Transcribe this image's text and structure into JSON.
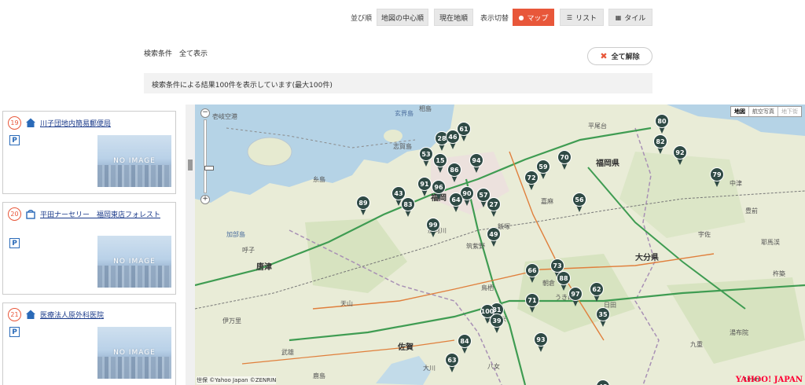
{
  "toolbar": {
    "sort_label": "並び順",
    "sort_center": "地図の中心順",
    "sort_current": "現在地順",
    "view_label": "表示切替",
    "view_map": "マップ",
    "view_list": "リスト",
    "view_tile": "タイル"
  },
  "conditions": {
    "label": "検索条件",
    "value": "全て表示",
    "clear": "全て解除"
  },
  "result_text": "検索条件による結果100件を表示しています(最大100件)",
  "list": [
    {
      "num": "19",
      "title": "川子団地内簡易郵便局",
      "category_icon": "house-icon",
      "parking": "P",
      "image_text": "NO IMAGE"
    },
    {
      "num": "20",
      "title": "平田ナーセリー　福岡東店フォレスト",
      "category_icon": "shop-icon",
      "parking": "P",
      "image_text": "NO IMAGE"
    },
    {
      "num": "21",
      "title": "医療法人原外科医院",
      "category_icon": "house-icon",
      "parking": "P",
      "image_text": "NO IMAGE"
    }
  ],
  "map": {
    "type_buttons": [
      "地図",
      "航空写真",
      "地下街"
    ],
    "credit": "世保  ©Yahoo Japan ©ZENRIN",
    "scale": "10 km",
    "logo": "YAHOO! JAPAN",
    "accent": "#e8573a",
    "marker_color": "#2f4a45",
    "place_labels": [
      {
        "text": "壱岐空港"
      },
      {
        "text": "玄界島"
      },
      {
        "text": "相島"
      },
      {
        "text": "志賀島"
      },
      {
        "text": "平尾台"
      },
      {
        "text": "福岡県"
      },
      {
        "text": "大分県"
      },
      {
        "text": "佐賀"
      },
      {
        "text": "唐津"
      },
      {
        "text": "福岡"
      },
      {
        "text": "那珂川"
      },
      {
        "text": "久留米"
      },
      {
        "text": "鳥栖"
      },
      {
        "text": "筑紫野"
      },
      {
        "text": "飯塚"
      },
      {
        "text": "嘉麻"
      },
      {
        "text": "朝倉"
      },
      {
        "text": "日田"
      },
      {
        "text": "中津"
      },
      {
        "text": "豊前"
      },
      {
        "text": "糸島"
      },
      {
        "text": "伊万里"
      },
      {
        "text": "武雄"
      },
      {
        "text": "鹿島"
      },
      {
        "text": "大川"
      },
      {
        "text": "八女"
      },
      {
        "text": "うきは"
      },
      {
        "text": "耶馬渓"
      },
      {
        "text": "宇佐"
      },
      {
        "text": "加部島"
      },
      {
        "text": "呼子"
      },
      {
        "text": "天山"
      },
      {
        "text": "九重"
      },
      {
        "text": "杵築"
      },
      {
        "text": "湯布院"
      }
    ],
    "markers": [
      "61",
      "80",
      "53",
      "28",
      "46",
      "15",
      "94",
      "86",
      "82",
      "92",
      "70",
      "59",
      "72",
      "79",
      "91",
      "96",
      "90",
      "57",
      "27",
      "43",
      "83",
      "64",
      "56",
      "89",
      "99",
      "49",
      "66",
      "73",
      "88",
      "62",
      "97",
      "71",
      "63",
      "81",
      "100",
      "39",
      "35",
      "84",
      "93",
      "48"
    ]
  }
}
